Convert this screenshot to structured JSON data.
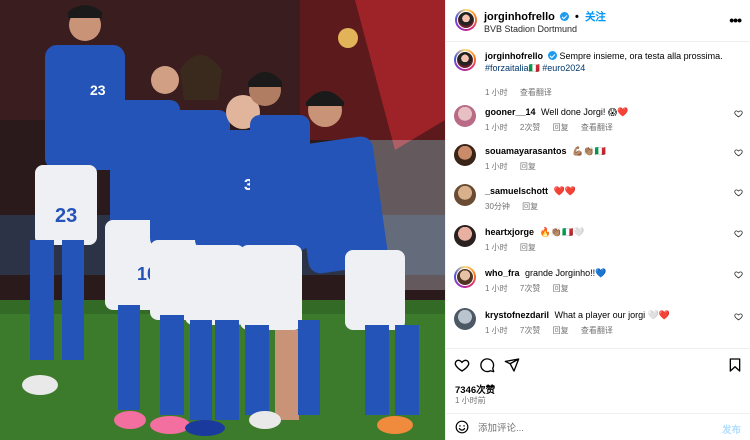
{
  "header": {
    "username": "jorginhofrello",
    "follow_label": "关注",
    "location": "BVB Stadion Dortmund",
    "more_icon": "more-horizontal-icon"
  },
  "caption": {
    "username": "jorginhofrello",
    "text": "Sempre insieme, ora testa alla prossima.",
    "hashtags": "#forzaitalia🇮🇹 #euro2024",
    "time": "1 小时",
    "translate": "查看翻译"
  },
  "comments": [
    {
      "username": "gooner__14",
      "text": "Well done Jorgi! 😱❤️",
      "time": "1 小时",
      "likes": "2次赞",
      "reply": "回复",
      "translate": "查看翻译"
    },
    {
      "username": "souamayarasantos",
      "text": "💪🏽👏🏽🇮🇹",
      "time": "1 小时",
      "likes": "",
      "reply": "回复",
      "translate": ""
    },
    {
      "username": "_samuelschott",
      "text": "❤️❤️",
      "time": "30分钟",
      "likes": "",
      "reply": "回复",
      "translate": ""
    },
    {
      "username": "heartxjorge",
      "text": "🔥👏🏽🇮🇹🤍",
      "time": "1 小时",
      "likes": "",
      "reply": "回复",
      "translate": ""
    },
    {
      "username": "who_fra",
      "text": "grande Jorginho!!💙",
      "time": "1 小时",
      "likes": "7次赞",
      "reply": "回复",
      "translate": ""
    },
    {
      "username": "krystofnezdaril",
      "text": "What a player our jorgi 🤍❤️",
      "time": "1 小时",
      "likes": "7次赞",
      "reply": "回复",
      "translate": "查看翻译"
    }
  ],
  "actions": {
    "likes": "7346次赞",
    "time": "1 小时前",
    "icons": [
      "heart-icon",
      "comment-icon",
      "share-icon",
      "bookmark-icon"
    ]
  },
  "comment_box": {
    "placeholder": "添加评论...",
    "post_label": "发布"
  },
  "colors": {
    "link": "#00376b",
    "follow": "#0095f6",
    "post_disabled": "#b2dffc",
    "heart": "#ed4956",
    "muted": "#737373",
    "jersey": "#2454b8"
  }
}
